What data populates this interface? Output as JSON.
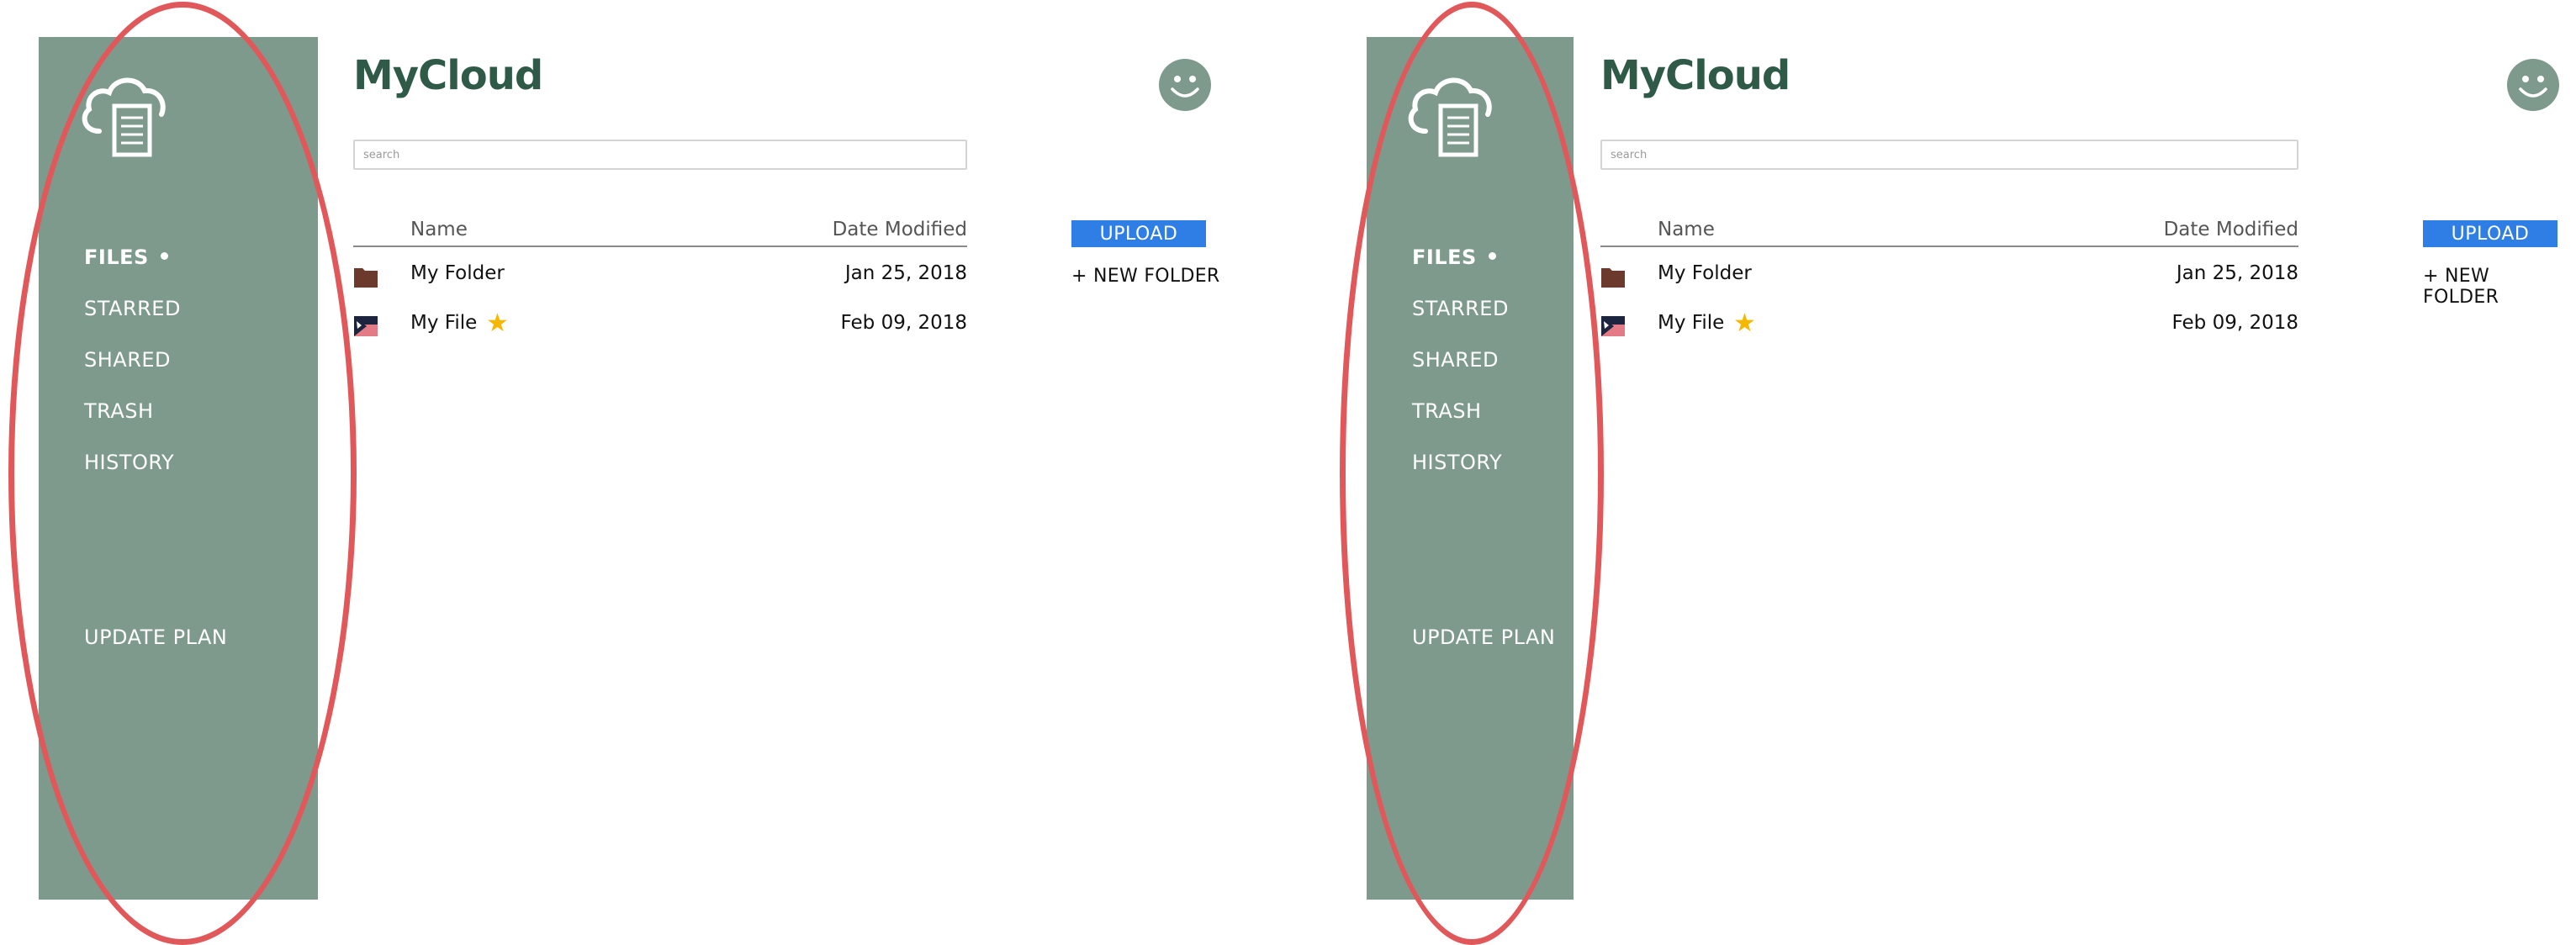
{
  "app": {
    "brand": "MyCloud"
  },
  "sidebar": {
    "items": [
      {
        "label": "FILES",
        "active": true
      },
      {
        "label": "STARRED"
      },
      {
        "label": "SHARED"
      },
      {
        "label": "TRASH"
      },
      {
        "label": "HISTORY"
      }
    ],
    "update_plan": "UPDATE PLAN",
    "logo_icon": "cloud-document-icon"
  },
  "search": {
    "placeholder": "search",
    "value": ""
  },
  "table": {
    "headers": {
      "name": "Name",
      "date": "Date Modified"
    },
    "rows": [
      {
        "name": "My Folder",
        "date": "Jan 25, 2018",
        "icon": "folder-icon",
        "starred": false
      },
      {
        "name": "My File",
        "date": "Feb 09, 2018",
        "icon": "file-thumbnail-icon",
        "starred": true
      }
    ]
  },
  "actions": {
    "upload": "UPLOAD",
    "new_folder": "+ NEW FOLDER"
  },
  "colors": {
    "sidebar_bg": "#7e9a8c",
    "brand": "#2f5a48",
    "upload_bg": "#2f7ee6",
    "annotation_oval": "#e0585a",
    "star": "#f5b800",
    "folder": "#6b3a2c"
  }
}
